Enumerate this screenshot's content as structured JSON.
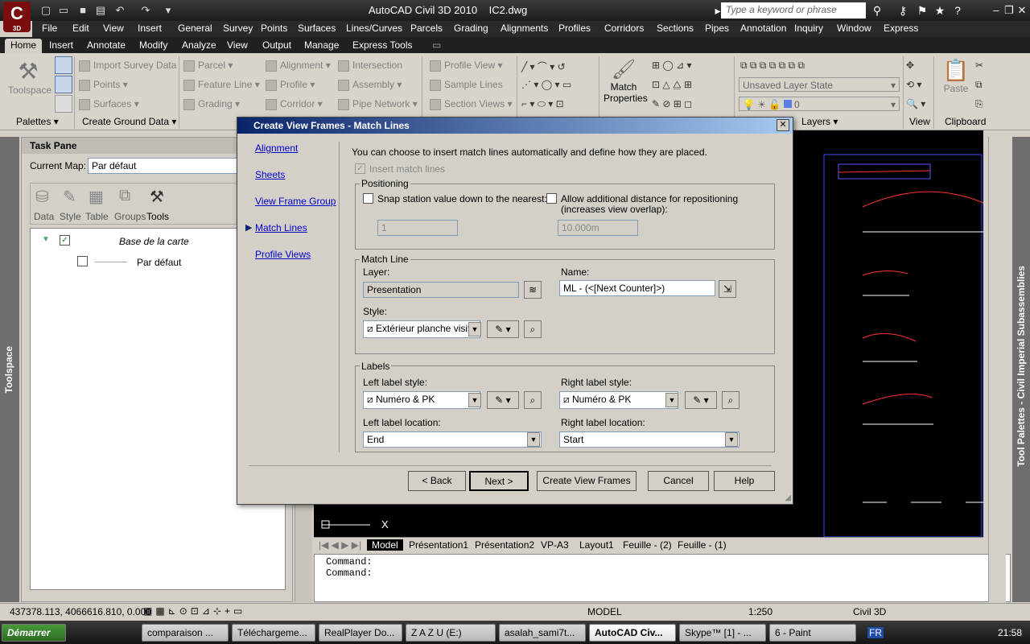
{
  "app": {
    "title": "AutoCAD Civil 3D 2010",
    "file": "IC2.dwg",
    "logo_text": "C",
    "badge": "3D",
    "search_placeholder": "Type a keyword or phrase"
  },
  "menu": [
    "File",
    "Edit",
    "View",
    "Insert",
    "General",
    "Survey",
    "Points",
    "Surfaces",
    "Lines/Curves",
    "Parcels",
    "Grading",
    "Alignments",
    "Profiles",
    "Corridors",
    "Sections",
    "Pipes",
    "Annotation",
    "Inquiry",
    "Window",
    "Express"
  ],
  "ribbon_tabs": [
    "Home",
    "Insert",
    "Annotate",
    "Modify",
    "Analyze",
    "View",
    "Output",
    "Manage",
    "Express Tools"
  ],
  "ribbon": {
    "toolspace": "Toolspace",
    "import_survey": "Import Survey Data",
    "points": "Points",
    "surfaces": "Surfaces",
    "parcel": "Parcel",
    "feature_line": "Feature Line",
    "grading": "Grading",
    "alignment": "Alignment",
    "profile": "Profile",
    "corridor": "Corridor",
    "intersection": "Intersection",
    "assembly": "Assembly",
    "pipe_network": "Pipe Network",
    "profile_view": "Profile View",
    "sample_lines": "Sample Lines",
    "section_views": "Section Views",
    "match_properties_1": "Match",
    "match_properties_2": "Properties",
    "layer_state": "Unsaved Layer State",
    "layer_value": "0",
    "paste": "Paste",
    "panels": {
      "palettes": "Palettes",
      "create_ground": "Create Ground Data",
      "layers": "Layers",
      "view": "View",
      "clipboard": "Clipboard"
    }
  },
  "taskpane": {
    "title": "Task Pane",
    "current_map_label": "Current Map:",
    "current_map": "Par défaut",
    "tabs": [
      "Data",
      "Style",
      "Table",
      "Groups",
      "Tools"
    ],
    "tree_root": "Base de la carte",
    "tree_child": "Par défaut",
    "toolspace_label": "Toolspace"
  },
  "drawing": {
    "model_tabs": [
      "Model",
      "Présentation1",
      "Présentation2",
      "VP-A3",
      "Layout1",
      "Feuille - (2)",
      "Feuille - (1)"
    ],
    "axis_label": "X",
    "tool_palettes_label": "Tool Palettes - Civil Imperial Subassemblies"
  },
  "command": {
    "line1": "Command:",
    "line2": "Command:"
  },
  "statusbar": {
    "coords": "437378.113, 4066616.810, 0.000",
    "model": "MODEL",
    "scale": "1:250",
    "workspace": "Civil 3D"
  },
  "taskbar": {
    "start": "Démarrer",
    "tasks": [
      "comparaison ...",
      "Téléchargeme...",
      "RealPlayer Do...",
      "Z A Z U (E:)",
      "asalah_sami7t...",
      "AutoCAD Civ...",
      "Skype™ [1] - ...",
      "6 - Paint"
    ],
    "lang": "FR",
    "time": "21:58"
  },
  "dialog": {
    "title": "Create View Frames - Match Lines",
    "nav": [
      "Alignment",
      "Sheets",
      "View Frame Group",
      "Match Lines",
      "Profile Views"
    ],
    "active_nav": "Match Lines",
    "intro": "You can choose to insert match lines automatically and define how they are placed.",
    "insert_match_lines": "Insert match lines",
    "positioning": {
      "legend": "Positioning",
      "snap_label": "Snap station value down to the nearest:",
      "snap_value": "1",
      "allow_label_1": "Allow additional distance for repositioning",
      "allow_label_2": "(increases view overlap):",
      "allow_value": "10.000m"
    },
    "match_line": {
      "legend": "Match Line",
      "layer_label": "Layer:",
      "layer_value": "Presentation",
      "name_label": "Name:",
      "name_value": "ML - (<[Next Counter]>)",
      "style_label": "Style:",
      "style_value": "Extérieur planche visit"
    },
    "labels": {
      "legend": "Labels",
      "left_style_label": "Left label style:",
      "left_style_value": "Numéro & PK",
      "right_style_label": "Right label style:",
      "right_style_value": "Numéro & PK",
      "left_loc_label": "Left label location:",
      "left_loc_value": "End",
      "right_loc_label": "Right label location:",
      "right_loc_value": "Start"
    },
    "buttons": {
      "back": "< Back",
      "next": "Next >",
      "create": "Create View Frames",
      "cancel": "Cancel",
      "help": "Help"
    }
  }
}
